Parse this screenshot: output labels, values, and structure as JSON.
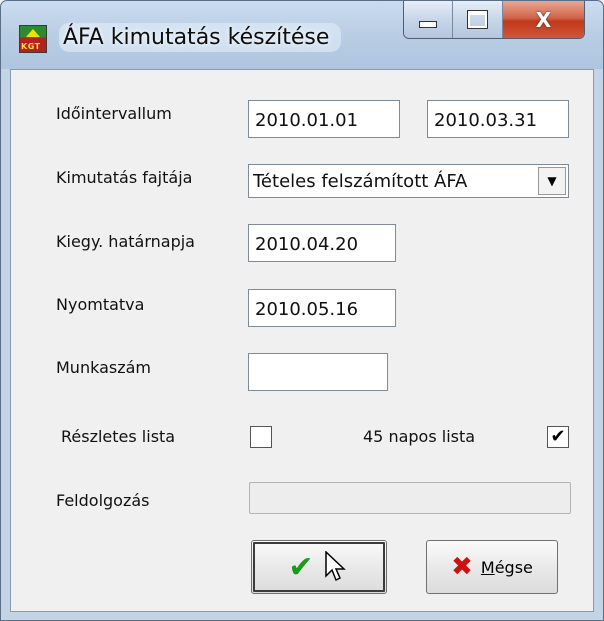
{
  "window": {
    "title": "ÁFA kimutatás készítése",
    "app_icon": "kgt-app-icon",
    "app_icon_text": "KGT",
    "controls": {
      "minimize": "minimize-icon",
      "maximize": "maximize-icon",
      "close": "close-icon",
      "close_glyph": "X"
    }
  },
  "form": {
    "interval_label": "Időintervallum",
    "interval_from": "2010.01.01",
    "interval_to": "2010.03.31",
    "type_label": "Kimutatás fajtája",
    "type_value": "Tételes felszámított ÁFA",
    "deadline_label": "Kiegy. határnapja",
    "deadline_value": "2010.04.20",
    "printed_label": "Nyomtatva",
    "printed_value": "2010.05.16",
    "jobnumber_label": "Munkaszám",
    "jobnumber_value": "",
    "detailed_label": "Részletes lista",
    "detailed_checked": false,
    "napos_label": "45 napos lista",
    "napos_checked": true,
    "processing_label": "Feldolgozás",
    "processing_progress": 0
  },
  "buttons": {
    "ok_label": "OK",
    "cancel_label": "Mégse"
  },
  "colors": {
    "title_bar": "#b9cde4",
    "ok_check": "#1a9b1a",
    "cancel_x": "#cc1111",
    "close_button": "#c1391a"
  }
}
